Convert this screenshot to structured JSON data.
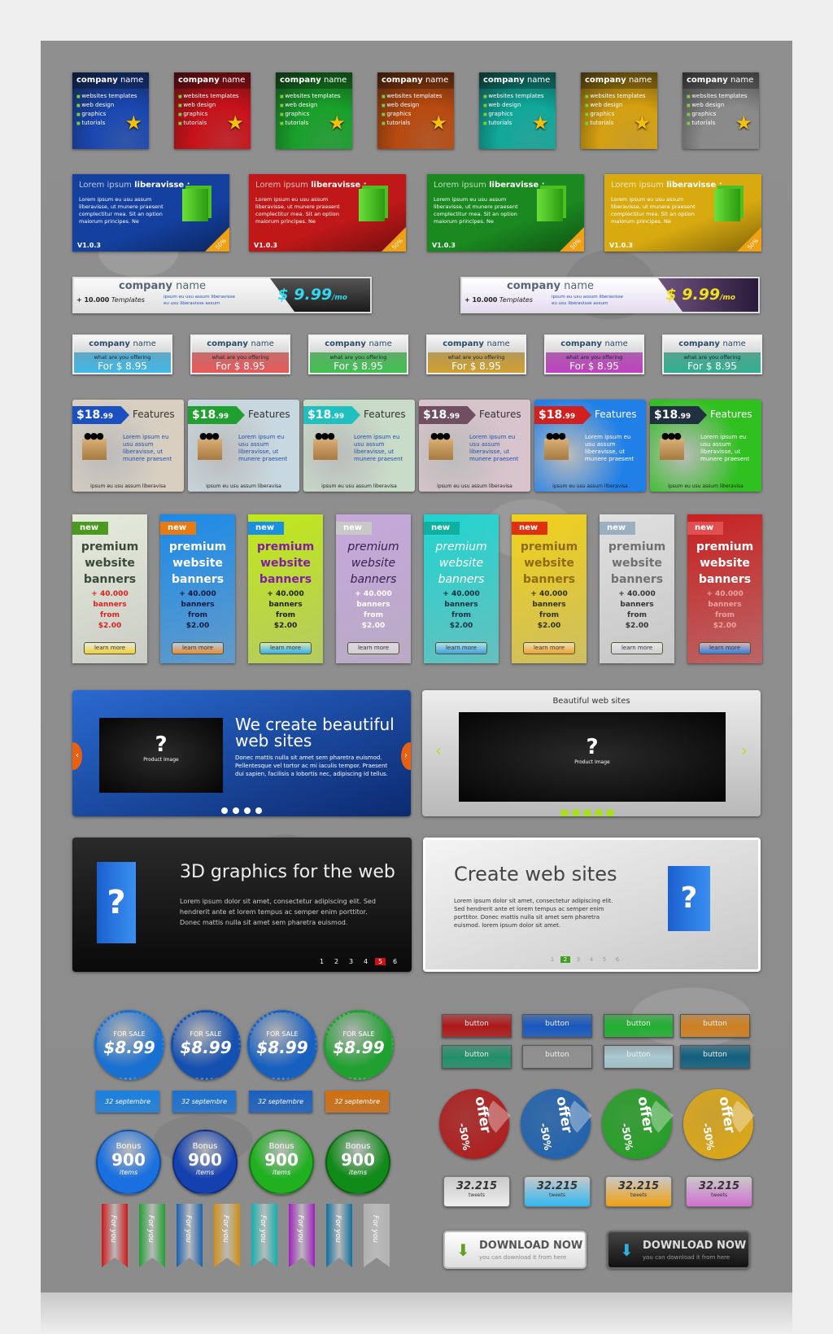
{
  "row1": {
    "title_bold": "company",
    "title_light": "name",
    "bullets": [
      "websites templates",
      "web design",
      "graphics",
      "tutorials"
    ],
    "themes": [
      "#1a47b0",
      "#c8121a",
      "#18a02a",
      "#b84a10",
      "#10a89a",
      "#d6a010",
      "#8a8a8a"
    ]
  },
  "row2": {
    "heading_light": "Lorem ipsum",
    "heading_bold": "liberavisse :",
    "body": "Lorem ipsum eu usu assum liberavisse, ut munere praesent complectitur mea. Sit an option maiorum principes. Ne",
    "version": "V1.0.3",
    "badge": "50%",
    "themes": [
      "#1440a0",
      "#c01818",
      "#1a8a20",
      "#d8aa10"
    ]
  },
  "row3": [
    {
      "title_bold": "company",
      "title_light": "name",
      "count": "+ 10.000",
      "count_label": "Templates",
      "bullets": [
        "ipsum eu usu assum liberavisse",
        "eu usu liberavisse assum"
      ],
      "price": "$ 9.99",
      "period": "/mo",
      "accent": "#30d8f0"
    },
    {
      "title_bold": "company",
      "title_light": "name",
      "count": "+ 10.000",
      "count_label": "Templates",
      "bullets": [
        "ipsum eu usu assum liberavisse",
        "eu usu liberavisse assum"
      ],
      "price": "$ 9.99",
      "period": "/mo",
      "accent": "#f0e020"
    }
  ],
  "row4": {
    "title_bold": "company",
    "title_light": "name",
    "subtitle": "what are you offering",
    "price": "For $ 8.95",
    "themes": [
      "#40b8e8",
      "#e85858",
      "#40c050",
      "#d0a030",
      "#c040c0",
      "#30b090"
    ]
  },
  "row5": {
    "price_main": "$18",
    "price_cents": ".99",
    "label": "Features",
    "body": "Lorem ipsum eu usu assum liberavisse, ut munere praesent",
    "footer": "ipsum eu usu assum liberavisa",
    "themes": [
      {
        "bg": "#d8cfc0",
        "tag": "#1a50c0"
      },
      {
        "bg": "#c8d8e0",
        "tag": "#20a030"
      },
      {
        "bg": "#c8dcc8",
        "tag": "#20c0c0"
      },
      {
        "bg": "#d8c4cc",
        "tag": "#705060"
      },
      {
        "bg": "#2080e8",
        "tag": "#d02020"
      },
      {
        "bg": "#30c020",
        "tag": "#203040"
      }
    ]
  },
  "row6": {
    "badge": "new",
    "title": [
      "premium",
      "website",
      "banners"
    ],
    "count": "+ 40.000",
    "lines": [
      "banners",
      "from",
      "$2.00"
    ],
    "button": "learn more",
    "themes": [
      {
        "bg": "#e6ecdc",
        "badge": "#4a9a20",
        "title": "#3a4a3a",
        "count": "#e02020",
        "btn": "#f0d030"
      },
      {
        "bg": "#1a8ae8",
        "badge": "#e87a10",
        "title": "#ffffff",
        "count": "#0a1a40",
        "btn": "#f08a30"
      },
      {
        "bg": "#c0e818",
        "badge": "#1a90e0",
        "title": "#8020a0",
        "count": "#202000",
        "btn": "#30b0f0"
      },
      {
        "bg": "#c6a8dc",
        "badge": "#c8c8c8",
        "title": "#3a2050",
        "count": "#ffffff",
        "btn": "#d0d0d0"
      },
      {
        "bg": "#20d4d0",
        "badge": "#10b0a0",
        "title": "#ffffff",
        "count": "#103040",
        "btn": "#40a0e0"
      },
      {
        "bg": "#f0d018",
        "badge": "#e03010",
        "title": "#906a10",
        "count": "#303000",
        "btn": "#f0a030"
      },
      {
        "bg": "#e0e0e0",
        "badge": "#9ab0c0",
        "title": "#707070",
        "count": "#333333",
        "btn": "#d0d0d0"
      },
      {
        "bg": "#c82020",
        "badge": "#e05050",
        "title": "#ffffff",
        "count": "#f0a0a0",
        "btn": "#3080e0"
      }
    ]
  },
  "slider_blue": {
    "title": "We create beautiful web sites",
    "body": "Donec mattis nulla sit amet sem pharetra euismod. Pellentesque vel tortor ac mi iaculis tempor. Praesent dui sapien, facilisis a lobortis nec, adipiscing id tellus.",
    "image_q": "?",
    "image_label": "Product Image",
    "dots": 4
  },
  "slider_silver": {
    "title": "Beautiful web sites",
    "image_q": "?",
    "image_label": "Product Image",
    "dots": 5
  },
  "slider_dark": {
    "title": "3D graphics for the web",
    "body": "Lorem ipsum dolor sit amet, consectetur adipiscing elit. Sed hendrerit ante et lorem tempus ac semper enim porttitor. Donec mattis nulla sit amet sem pharetra euismod.",
    "pages": [
      "1",
      "2",
      "3",
      "4",
      "5",
      "6"
    ],
    "active_page": "5"
  },
  "slider_light": {
    "title": "Create web sites",
    "body": "Lorem ipsum dolor sit amet, consectetur adipiscing elit. Sed hendrerit ante et lorem tempus ac semper enim porttitor. Donec mattis nulla sit amet sem pharetra euismod. lorem ipsum dolor sit amet.",
    "pages": [
      "1",
      "2",
      "3",
      "4",
      "5",
      "6"
    ],
    "active_page": "2"
  },
  "sale": {
    "top": "FOR SALE",
    "price": "$8.99",
    "colors": [
      "#1a70d0",
      "#1450b0",
      "#1860c0",
      "#20a030"
    ]
  },
  "date": {
    "label": "32 septembre",
    "colors": [
      "#1a80e0",
      "#1a70d0",
      "#1a60c0",
      "#d07010"
    ]
  },
  "bonus": {
    "label": "Bonus",
    "value": "900",
    "unit": "items",
    "colors": [
      "#1a70e0",
      "#1440b0",
      "#20b020",
      "#108a18"
    ]
  },
  "ribbon": {
    "label": "For you",
    "colors": [
      "#d01818",
      "#20a030",
      "#1a60b0",
      "#d09010",
      "#10b0b0",
      "#a020c0",
      "#1070a0",
      "#b0b0b0"
    ]
  },
  "buttons": {
    "label": "button",
    "colors": [
      "#b01818",
      "#1858c0",
      "#20b030",
      "#d08020",
      "#20906a",
      "#909090",
      "#a8c8d0",
      "#106080"
    ]
  },
  "offer": {
    "label": "offer",
    "discount": "-50%",
    "colors": [
      "#b01818",
      "#1a60b0",
      "#20a020",
      "#e0a810"
    ]
  },
  "tweets": {
    "count": "32.215",
    "label": "tweets",
    "colors": [
      "#eeeeee",
      "#30b8f0",
      "#f0a010",
      "#d070d0"
    ]
  },
  "download": [
    {
      "title": "DOWNLOAD NOW",
      "sub": "you can download it from here",
      "icon": "chevron-down-green",
      "theme": "light"
    },
    {
      "title": "DOWNLOAD NOW",
      "sub": "you can download it from here",
      "icon": "chevron-down-blue",
      "theme": "dark"
    }
  ]
}
